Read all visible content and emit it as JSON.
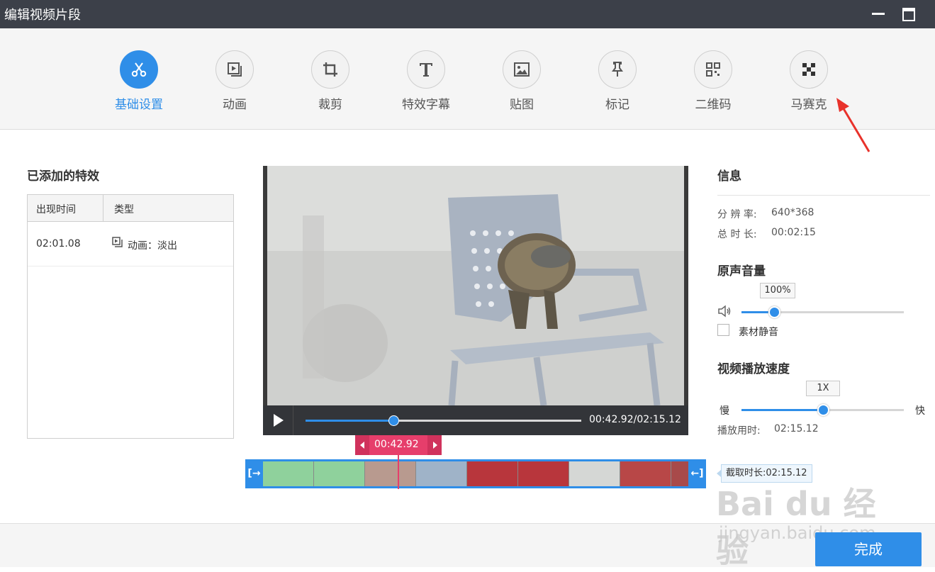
{
  "window": {
    "title": "编辑视频片段"
  },
  "toolbar": {
    "items": [
      {
        "label": "基础设置",
        "icon": "scissors-icon",
        "active": true
      },
      {
        "label": "动画",
        "icon": "animation-icon",
        "active": false
      },
      {
        "label": "裁剪",
        "icon": "crop-icon",
        "active": false
      },
      {
        "label": "特效字幕",
        "icon": "text-icon",
        "active": false
      },
      {
        "label": "贴图",
        "icon": "image-icon",
        "active": false
      },
      {
        "label": "标记",
        "icon": "pin-icon",
        "active": false
      },
      {
        "label": "二维码",
        "icon": "qrcode-icon",
        "active": false
      },
      {
        "label": "马赛克",
        "icon": "mosaic-icon",
        "active": false
      }
    ]
  },
  "effects": {
    "title": "已添加的特效",
    "columns": [
      "出现时间",
      "类型"
    ],
    "rows": [
      {
        "time": "02:01.08",
        "type": "动画：淡出",
        "icon": "animation-icon"
      }
    ]
  },
  "player": {
    "time_display": "00:42.92/02:15.12",
    "progress": 0.32,
    "current_label": "00:42.92"
  },
  "timeline": {
    "cut_label": "截取时长:02:15.12",
    "left_handle": "[→",
    "right_handle": "←]"
  },
  "info": {
    "title": "信息",
    "resolution_label": "分 辨 率:",
    "resolution": "640*368",
    "duration_label": "总 时 长:",
    "duration": "00:02:15"
  },
  "volume": {
    "title": "原声音量",
    "value_label": "100%",
    "level": 0.2,
    "mute_label": "素材静音",
    "muted": false
  },
  "speed": {
    "title": "视频播放速度",
    "value_label": "1X",
    "level": 0.5,
    "slow": "慢",
    "fast": "快",
    "play_time_label": "播放用时:",
    "play_time": "02:15.12"
  },
  "done_label": "完成",
  "watermark": {
    "main": "Bai du 经验",
    "url": "jingyan.baidu.com"
  },
  "colors": {
    "accent": "#2f8ee8",
    "marker": "#e63e6b",
    "titlebar": "#3c4049"
  }
}
